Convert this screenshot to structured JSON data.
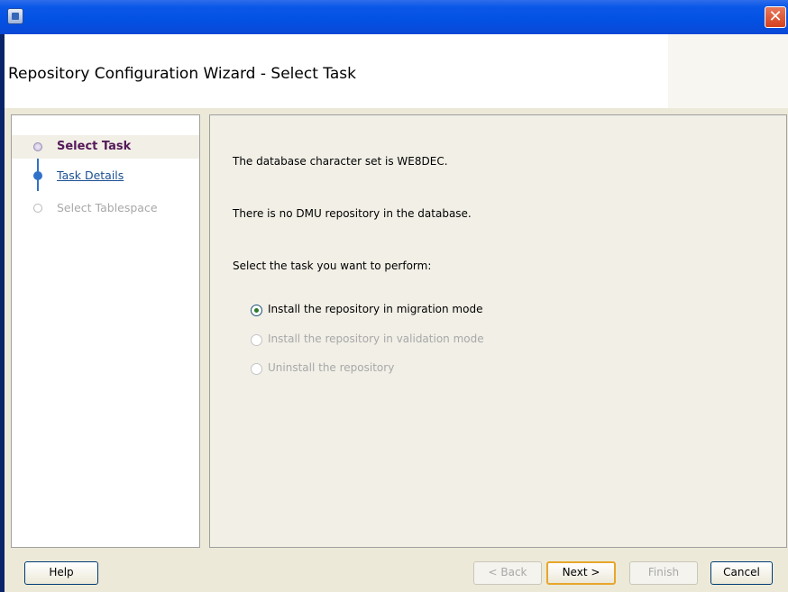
{
  "window": {
    "title": "",
    "close_glyph": "✕",
    "icons": {
      "app": "app-icon",
      "close": "close-icon"
    }
  },
  "header": {
    "title": "Repository Configuration Wizard - Select Task"
  },
  "nav": {
    "steps": [
      {
        "label": "Select Task",
        "state": "active"
      },
      {
        "label": "Task Details",
        "state": "link"
      },
      {
        "label": "Select Tablespace",
        "state": "disabled"
      }
    ]
  },
  "content": {
    "charset_msg": "The database character set is WE8DEC.",
    "repo_msg": "There is no DMU repository in the database.",
    "prompt": "Select the task you want to perform:",
    "options": [
      {
        "label": "Install the repository in migration mode",
        "checked": true,
        "enabled": true
      },
      {
        "label": "Install the repository in validation mode",
        "checked": false,
        "enabled": false
      },
      {
        "label": "Uninstall the repository",
        "checked": false,
        "enabled": false
      }
    ]
  },
  "buttons": {
    "help": "Help",
    "back": "< Back",
    "next": "Next >",
    "finish": "Finish",
    "cancel": "Cancel"
  },
  "colors": {
    "titlebar": "#0351e3",
    "active_step": "#551a59",
    "link": "#1a4e92",
    "disabled": "#a8a8a8",
    "default_button_border": "#e8a62b"
  }
}
